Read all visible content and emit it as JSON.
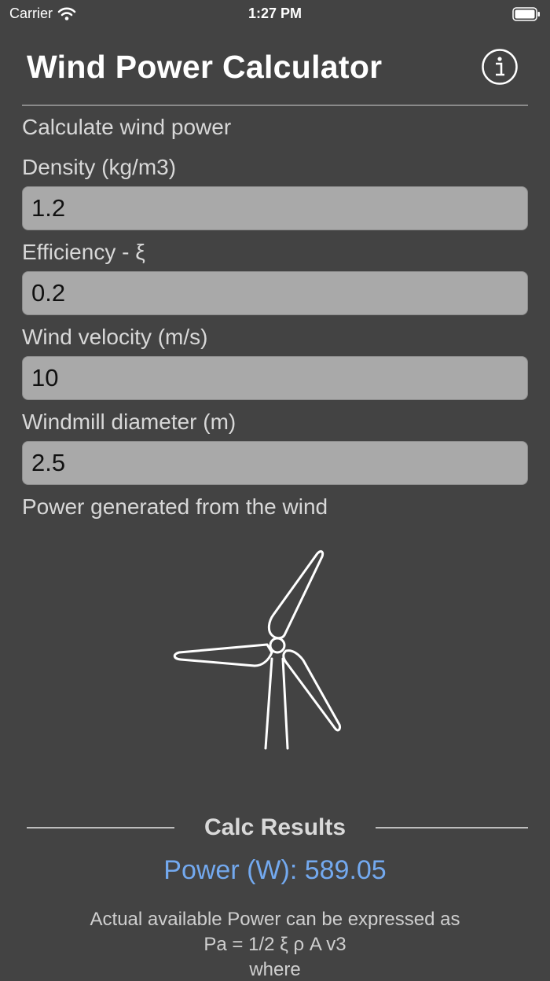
{
  "status_bar": {
    "carrier": "Carrier",
    "time": "1:27 PM",
    "icons": [
      "wifi-icon",
      "battery-icon"
    ]
  },
  "header": {
    "title": "Wind Power Calculator",
    "info_icon": "info-icon"
  },
  "form": {
    "intro": "Calculate wind power",
    "density_label": "Density (kg/m3)",
    "density_value": "1.2",
    "efficiency_label": "Efficiency - ξ",
    "efficiency_value": "0.2",
    "velocity_label": "Wind velocity (m/s)",
    "velocity_value": "10",
    "diameter_label": "Windmill diameter (m)",
    "diameter_value": "2.5",
    "output_label": "Power generated from the wind"
  },
  "illustration": {
    "icon": "wind-turbine-icon"
  },
  "results": {
    "title": "Calc Results",
    "power_text": "Power (W): 589.05",
    "explanation_line1": "Actual available Power can be expressed as",
    "explanation_line2": "Pa = 1/2 ξ ρ A v3",
    "explanation_line3": "where"
  },
  "colors": {
    "background": "#434343",
    "field_background": "#a9a9a9",
    "result_accent": "#73a9ef"
  }
}
